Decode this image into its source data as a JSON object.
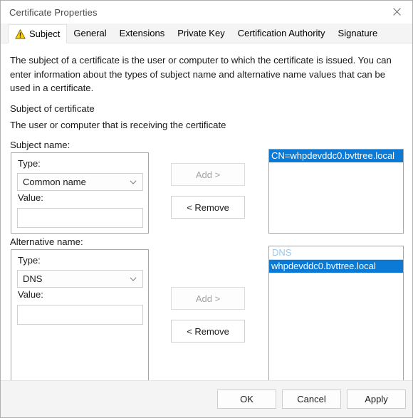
{
  "window": {
    "title": "Certificate Properties",
    "close_icon": "close-icon"
  },
  "tabs": [
    {
      "label": "Subject",
      "active": true,
      "icon": "warning-triangle-icon"
    },
    {
      "label": "General",
      "active": false
    },
    {
      "label": "Extensions",
      "active": false
    },
    {
      "label": "Private Key",
      "active": false
    },
    {
      "label": "Certification Authority",
      "active": false
    },
    {
      "label": "Signature",
      "active": false
    }
  ],
  "subject_tab": {
    "description": "The subject of a certificate is the user or computer to which the certificate is issued. You can enter information about the types of subject name and alternative name values that can be used in a certificate.",
    "section_title": "Subject of certificate",
    "section_subtitle": "The user or computer that is receiving the certificate",
    "subject_name": {
      "label": "Subject name:",
      "type_label": "Type:",
      "type_value": "Common name",
      "value_label": "Value:",
      "value_text": "",
      "add_label": "Add >",
      "add_enabled": false,
      "remove_label": "< Remove",
      "remove_enabled": true,
      "list_items": [
        {
          "text": "CN=whpdevddc0.bvttree.local",
          "selected": true
        }
      ]
    },
    "alternative_name": {
      "label": "Alternative name:",
      "type_label": "Type:",
      "type_value": "DNS",
      "value_label": "Value:",
      "value_text": "",
      "add_label": "Add >",
      "add_enabled": false,
      "remove_label": "< Remove",
      "remove_enabled": true,
      "group_header": "DNS",
      "list_items": [
        {
          "text": "whpdevddc0.bvttree.local",
          "selected": true
        }
      ]
    }
  },
  "footer": {
    "ok_label": "OK",
    "cancel_label": "Cancel",
    "apply_label": "Apply"
  },
  "colors": {
    "selection_blue": "#0a7ad6",
    "group_header_blue": "#9ac7ea",
    "warning_yellow": "#ffd100"
  }
}
